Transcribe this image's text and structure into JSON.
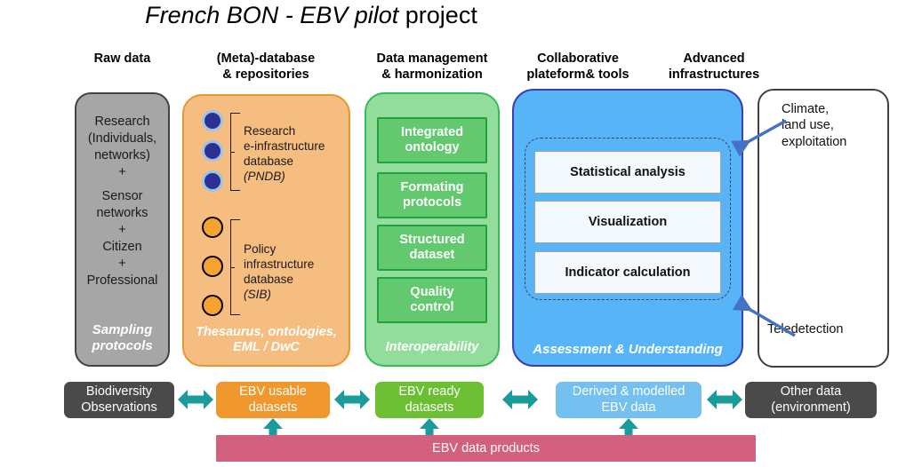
{
  "title": {
    "italic_part": "French BON - EBV pilot",
    "regular_part": " project"
  },
  "column_headers": [
    {
      "name": "raw-data",
      "line1": "Raw data",
      "line2": ""
    },
    {
      "name": "meta-database",
      "line1": "(Meta)-database",
      "line2": "& repositories"
    },
    {
      "name": "data-management",
      "line1": "Data management",
      "line2": "& harmonization"
    },
    {
      "name": "collaborative-platform",
      "line1": "Collaborative",
      "line2": "plateform& tools"
    },
    {
      "name": "advanced-infrastructures",
      "line1": "Advanced",
      "line2": "infrastructures"
    }
  ],
  "panels": {
    "raw": {
      "lines": [
        "Research",
        "(Individuals,",
        "networks)",
        "+",
        "",
        "Sensor",
        "networks",
        "+",
        "Citizen",
        "+",
        "Professional"
      ],
      "footer_line1": "Sampling",
      "footer_line2": "protocols",
      "color": "#a6a6a6",
      "border_color": "#3f4247"
    },
    "meta": {
      "group1": {
        "dot_count": 3,
        "dot_fill": "#2b3193",
        "dot_border": "#9dc3e6",
        "label_lines": [
          "Research",
          "e-infrastructure",
          "database"
        ],
        "label_sub": "(PNDB)"
      },
      "group2": {
        "dot_count": 3,
        "dot_fill": "#f5a231",
        "dot_border": "#000000",
        "label_lines": [
          "Policy",
          "infrastructure",
          "database"
        ],
        "label_sub": "(SIB)"
      },
      "footer_line1": "Thesaurus, ontologies,",
      "footer_line2": "EML / DwC",
      "color": "#f5bd7f",
      "border_color": "#e8962e"
    },
    "green": {
      "boxes": [
        {
          "line1": "Integrated",
          "line2": "ontology"
        },
        {
          "line1": "Formating",
          "line2": "protocols"
        },
        {
          "line1": "Structured",
          "line2": "dataset"
        },
        {
          "line1": "Quality",
          "line2": "control"
        }
      ],
      "footer": "Interoperability",
      "color": "#92dd9b",
      "border_color": "#35bb56",
      "box_color": "#62c96f"
    },
    "blue": {
      "boxes": [
        "Statistical analysis",
        "Visualization",
        "Indicator calculation"
      ],
      "footer": "Assessment & Understanding",
      "color": "#56b4f7",
      "border_color": "#3a3fb5"
    },
    "white": {
      "top_lines": [
        "Climate,",
        "land use,",
        "exploitation"
      ],
      "bottom_label": "Teledetection",
      "border_color": "#404040"
    }
  },
  "bottom_row": {
    "chips": [
      {
        "name": "biodiversity-observations",
        "line1": "Biodiversity",
        "line2": "Observations",
        "color": "#4a4a4a"
      },
      {
        "name": "ebv-usable-datasets",
        "line1": "EBV usable",
        "line2": "datasets",
        "color": "#f0982e"
      },
      {
        "name": "ebv-ready-datasets",
        "line1": "EBV ready",
        "line2": "datasets",
        "color": "#6cbe32"
      },
      {
        "name": "derived-modelled-ebv-data",
        "line1": "Derived & modelled",
        "line2": "EBV data",
        "color": "#74c0f0"
      },
      {
        "name": "other-data-environment",
        "line1": "Other data",
        "line2": "(environment)",
        "color": "#4a4a4a"
      }
    ],
    "pink_bar_label": "EBV data products",
    "pink_bar_color": "#d3607f",
    "arrow_color": "#1a9c9c"
  },
  "annotation_arrows": {
    "color": "#4472c4",
    "count": 2
  }
}
